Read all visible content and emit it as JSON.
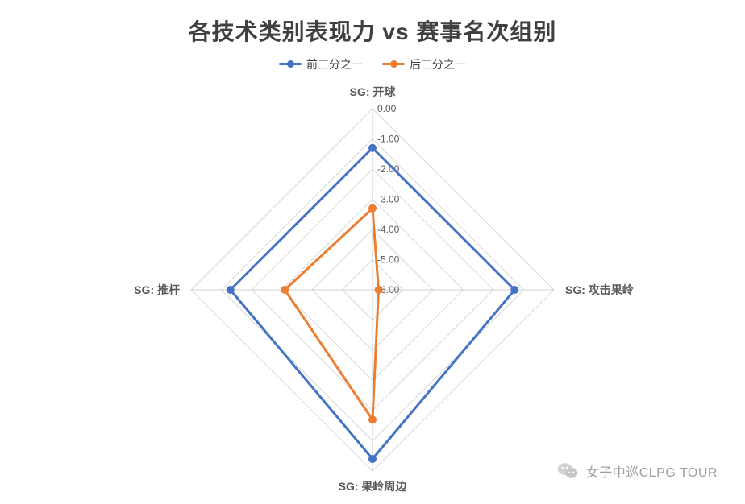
{
  "title": "各技术类别表现力 vs 赛事名次组别",
  "legend": {
    "series1": "前三分之一",
    "series2": "后三分之一"
  },
  "watermark": {
    "text": "女子中巡CLPG TOUR"
  },
  "colors": {
    "series1": "#4472C4",
    "series2": "#ED7D31",
    "grid": "#d9d9d9",
    "axis": "#d0d0d0",
    "text": "#595959"
  },
  "chart_data": {
    "type": "radar",
    "categories": [
      "SG: 开球",
      "SG: 攻击果岭",
      "SG: 果岭周边",
      "SG: 推杆"
    ],
    "axis_min": -6.0,
    "axis_max": 0.0,
    "ticks": [
      "0.00",
      "-1.00",
      "-2.00",
      "-3.00",
      "-4.00",
      "-5.00",
      "-6.00"
    ],
    "series": [
      {
        "name": "前三分之一",
        "color": "#4472C4",
        "values": [
          -1.3,
          -1.3,
          -0.4,
          -1.3
        ]
      },
      {
        "name": "后三分之一",
        "color": "#ED7D31",
        "values": [
          -3.3,
          -5.8,
          -1.7,
          -3.1
        ]
      }
    ]
  }
}
